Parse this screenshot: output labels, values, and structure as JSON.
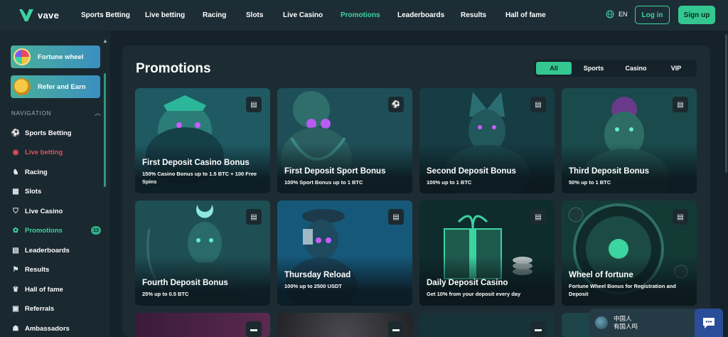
{
  "brand": {
    "name": "vave",
    "accent": "#3cd4a0"
  },
  "topnav": {
    "items": [
      {
        "label": "Sports Betting",
        "active": false
      },
      {
        "label": "Live betting",
        "active": false
      },
      {
        "label": "Racing",
        "active": false
      },
      {
        "label": "Slots",
        "active": false
      },
      {
        "label": "Live Casino",
        "active": false
      },
      {
        "label": "Promotions",
        "active": true
      },
      {
        "label": "Leaderboards",
        "active": false
      },
      {
        "label": "Results",
        "active": false
      },
      {
        "label": "Hall of fame",
        "active": false
      }
    ],
    "language": "EN",
    "login_label": "Log in",
    "signup_label": "Sign up"
  },
  "sidebar": {
    "promos": [
      {
        "label": "Fortune wheel",
        "icon": "fortune-wheel-icon"
      },
      {
        "label": "Refer and Earn",
        "icon": "coin-icon"
      }
    ],
    "heading": "NAVIGATION",
    "items": [
      {
        "label": "Sports Betting",
        "icon": "soccer-ball-icon"
      },
      {
        "label": "Live betting",
        "icon": "live-signal-icon"
      },
      {
        "label": "Racing",
        "icon": "horse-icon"
      },
      {
        "label": "Slots",
        "icon": "slot-machine-icon"
      },
      {
        "label": "Live Casino",
        "icon": "shield-card-icon"
      },
      {
        "label": "Promotions",
        "icon": "promotions-icon",
        "badge": "13"
      },
      {
        "label": "Leaderboards",
        "icon": "leaderboard-icon"
      },
      {
        "label": "Results",
        "icon": "flag-icon"
      },
      {
        "label": "Hall of fame",
        "icon": "trophy-icon"
      },
      {
        "label": "Referrals",
        "icon": "gift-icon"
      },
      {
        "label": "Ambassadors",
        "icon": "ambassador-icon"
      }
    ]
  },
  "main": {
    "title": "Promotions",
    "filters": [
      {
        "label": "All",
        "active": true
      },
      {
        "label": "Sports",
        "active": false
      },
      {
        "label": "Casino",
        "active": false
      },
      {
        "label": "VIP",
        "active": false
      }
    ],
    "cards": [
      {
        "title": "First Deposit Casino Bonus",
        "subtitle": "150% Casino Bonus up to 1.5 BTC + 100 Free Spins",
        "tag_icon": "casino-icon",
        "theme": "#1f5a63"
      },
      {
        "title": "First Deposit Sport Bonus",
        "subtitle": "100% Sport Bonus up to 1 BTC",
        "tag_icon": "soccer-ball-icon",
        "theme": "#1e4f58"
      },
      {
        "title": "Second Deposit Bonus",
        "subtitle": "100% up to 1 BTC",
        "tag_icon": "casino-icon",
        "theme": "#163c44"
      },
      {
        "title": "Third Deposit Bonus",
        "subtitle": "50% up to 1 BTC",
        "tag_icon": "casino-icon",
        "theme": "#1a4a4c"
      },
      {
        "title": "Fourth Deposit Bonus",
        "subtitle": "25% up to 0.5 BTC",
        "tag_icon": "casino-icon",
        "theme": "#1d4f55"
      },
      {
        "title": "Thursday Reload",
        "subtitle": "100% up to 2500 USDT",
        "tag_icon": "casino-icon",
        "theme": "#16587a"
      },
      {
        "title": "Daily Deposit Casino",
        "subtitle": "Get 10% from your deposit every day",
        "tag_icon": "casino-icon",
        "theme": "#0f2c2c"
      },
      {
        "title": "Wheel of fortune",
        "subtitle": "Fortune Wheel Bonus for Registration and Deposit",
        "tag_icon": "casino-icon",
        "theme": "#143a36"
      },
      {
        "title": "",
        "subtitle": "",
        "tag_icon": "ticket-icon",
        "theme": "#3a1a3a"
      },
      {
        "title": "",
        "subtitle": "",
        "tag_icon": "casino-icon",
        "theme": "#2a2a2e"
      },
      {
        "title": "",
        "subtitle": "",
        "tag_icon": "casino-icon",
        "theme": "#173238"
      },
      {
        "title": "",
        "subtitle": "",
        "tag_icon": "casino-icon",
        "theme": "#1d4448"
      }
    ]
  },
  "chat": {
    "line1": "中国人",
    "line2": "有国人吗"
  }
}
